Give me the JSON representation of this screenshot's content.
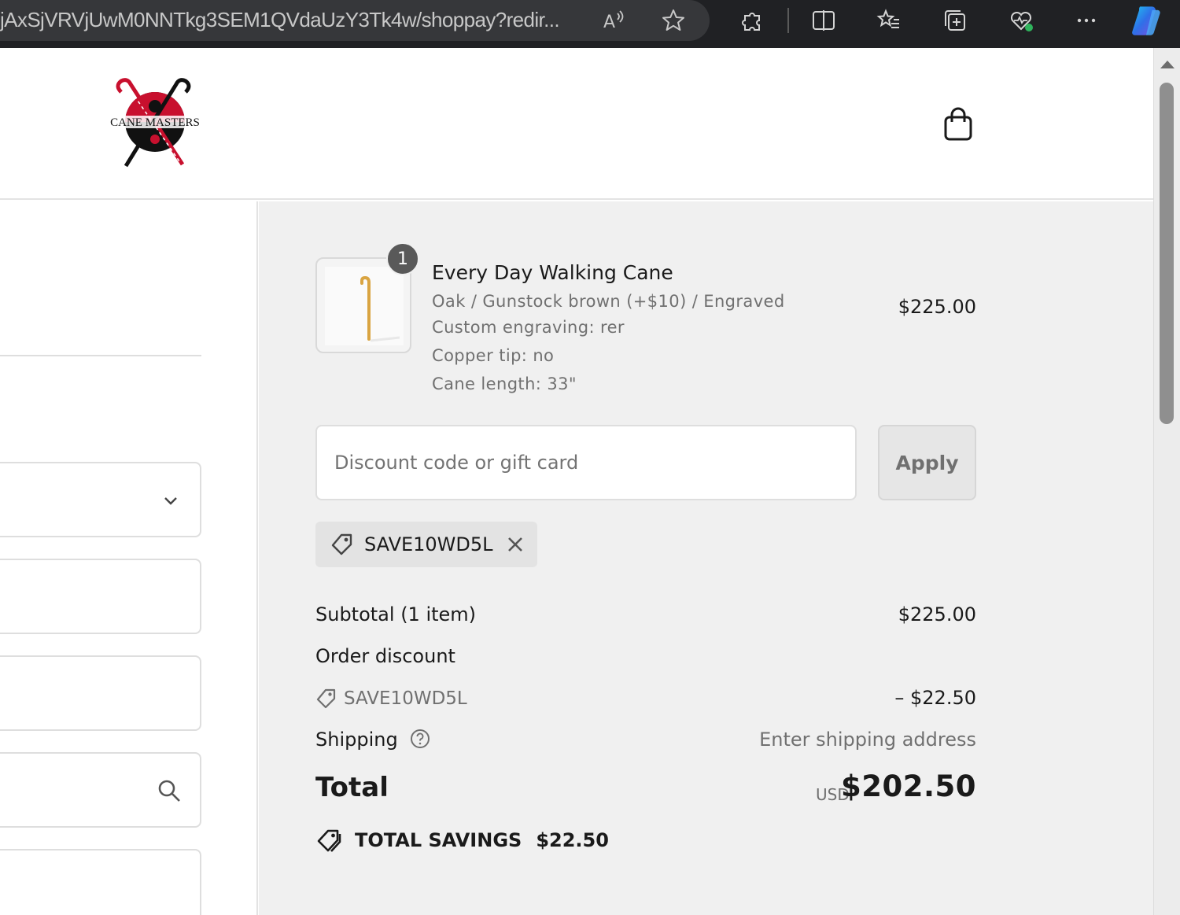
{
  "browser": {
    "url": "jAxSjVRVjUwM0NNTkg3SEM1QVdaUzY3Tk4w/shoppay?redir...",
    "icons": [
      "read-aloud-icon",
      "favorite-star-icon",
      "extensions-icon",
      "split-screen-icon",
      "favorites-icon",
      "collections-icon",
      "browser-essentials-icon",
      "more-icon",
      "copilot-icon"
    ]
  },
  "header": {
    "logo_text": "CANE MASTERS",
    "cart_icon": "shopping-bag-icon"
  },
  "order": {
    "item": {
      "quantity": "1",
      "name": "Every Day Walking Cane",
      "variant": "Oak / Gunstock brown (+$10) / Engraved",
      "engraving": "Custom engraving: rer",
      "copper_tip": "Copper tip: no",
      "length": "Cane length: 33\"",
      "price": "$225.00"
    },
    "discount": {
      "placeholder": "Discount code or gift card",
      "apply_label": "Apply",
      "applied_code": "SAVE10WD5L"
    },
    "summary": {
      "subtotal_label": "Subtotal (1 item)",
      "subtotal_value": "$225.00",
      "order_discount_label": "Order discount",
      "discount_code": "SAVE10WD5L",
      "discount_value": "– $22.50",
      "shipping_label": "Shipping",
      "shipping_value": "Enter shipping address",
      "total_label": "Total",
      "currency": "USD",
      "total_value": "$202.50",
      "savings_label": "TOTAL SAVINGS",
      "savings_value": "$22.50"
    }
  },
  "colors": {
    "chrome_bg": "#202124",
    "summary_bg": "#f0f0f0",
    "brand_red": "#c8102e"
  }
}
